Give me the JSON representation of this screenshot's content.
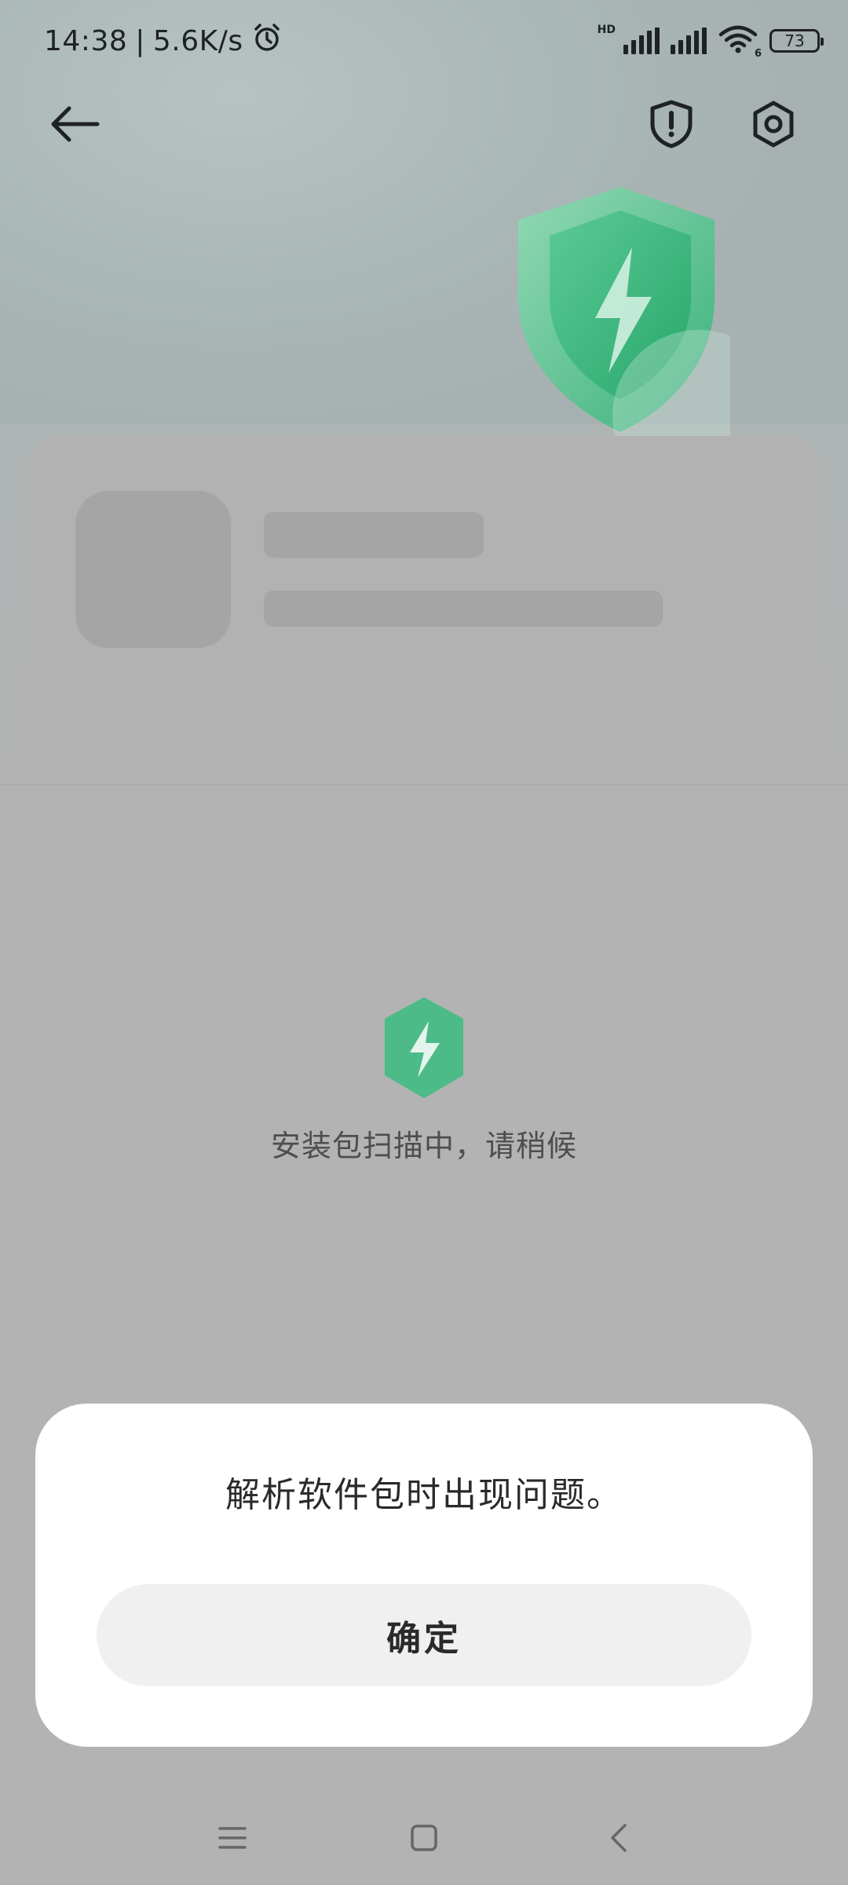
{
  "status_bar": {
    "time": "14:38",
    "separator": "|",
    "net_speed": "5.6K/s",
    "battery_level": "73",
    "signal_hd_label": "HD",
    "wifi_gen_label": "6"
  },
  "top_bar": {
    "back_icon": "arrow-left-icon",
    "report_icon": "shield-exclamation-icon",
    "settings_icon": "gear-icon"
  },
  "scan": {
    "status_text": "安装包扫描中，请稍候",
    "accent_color": "#4cc08a"
  },
  "dialog": {
    "message": "解析软件包时出现问题。",
    "confirm_label": "确定"
  },
  "nav_bar": {
    "menu_icon": "menu-icon",
    "home_icon": "home-square-icon",
    "back_icon": "chevron-left-icon"
  }
}
